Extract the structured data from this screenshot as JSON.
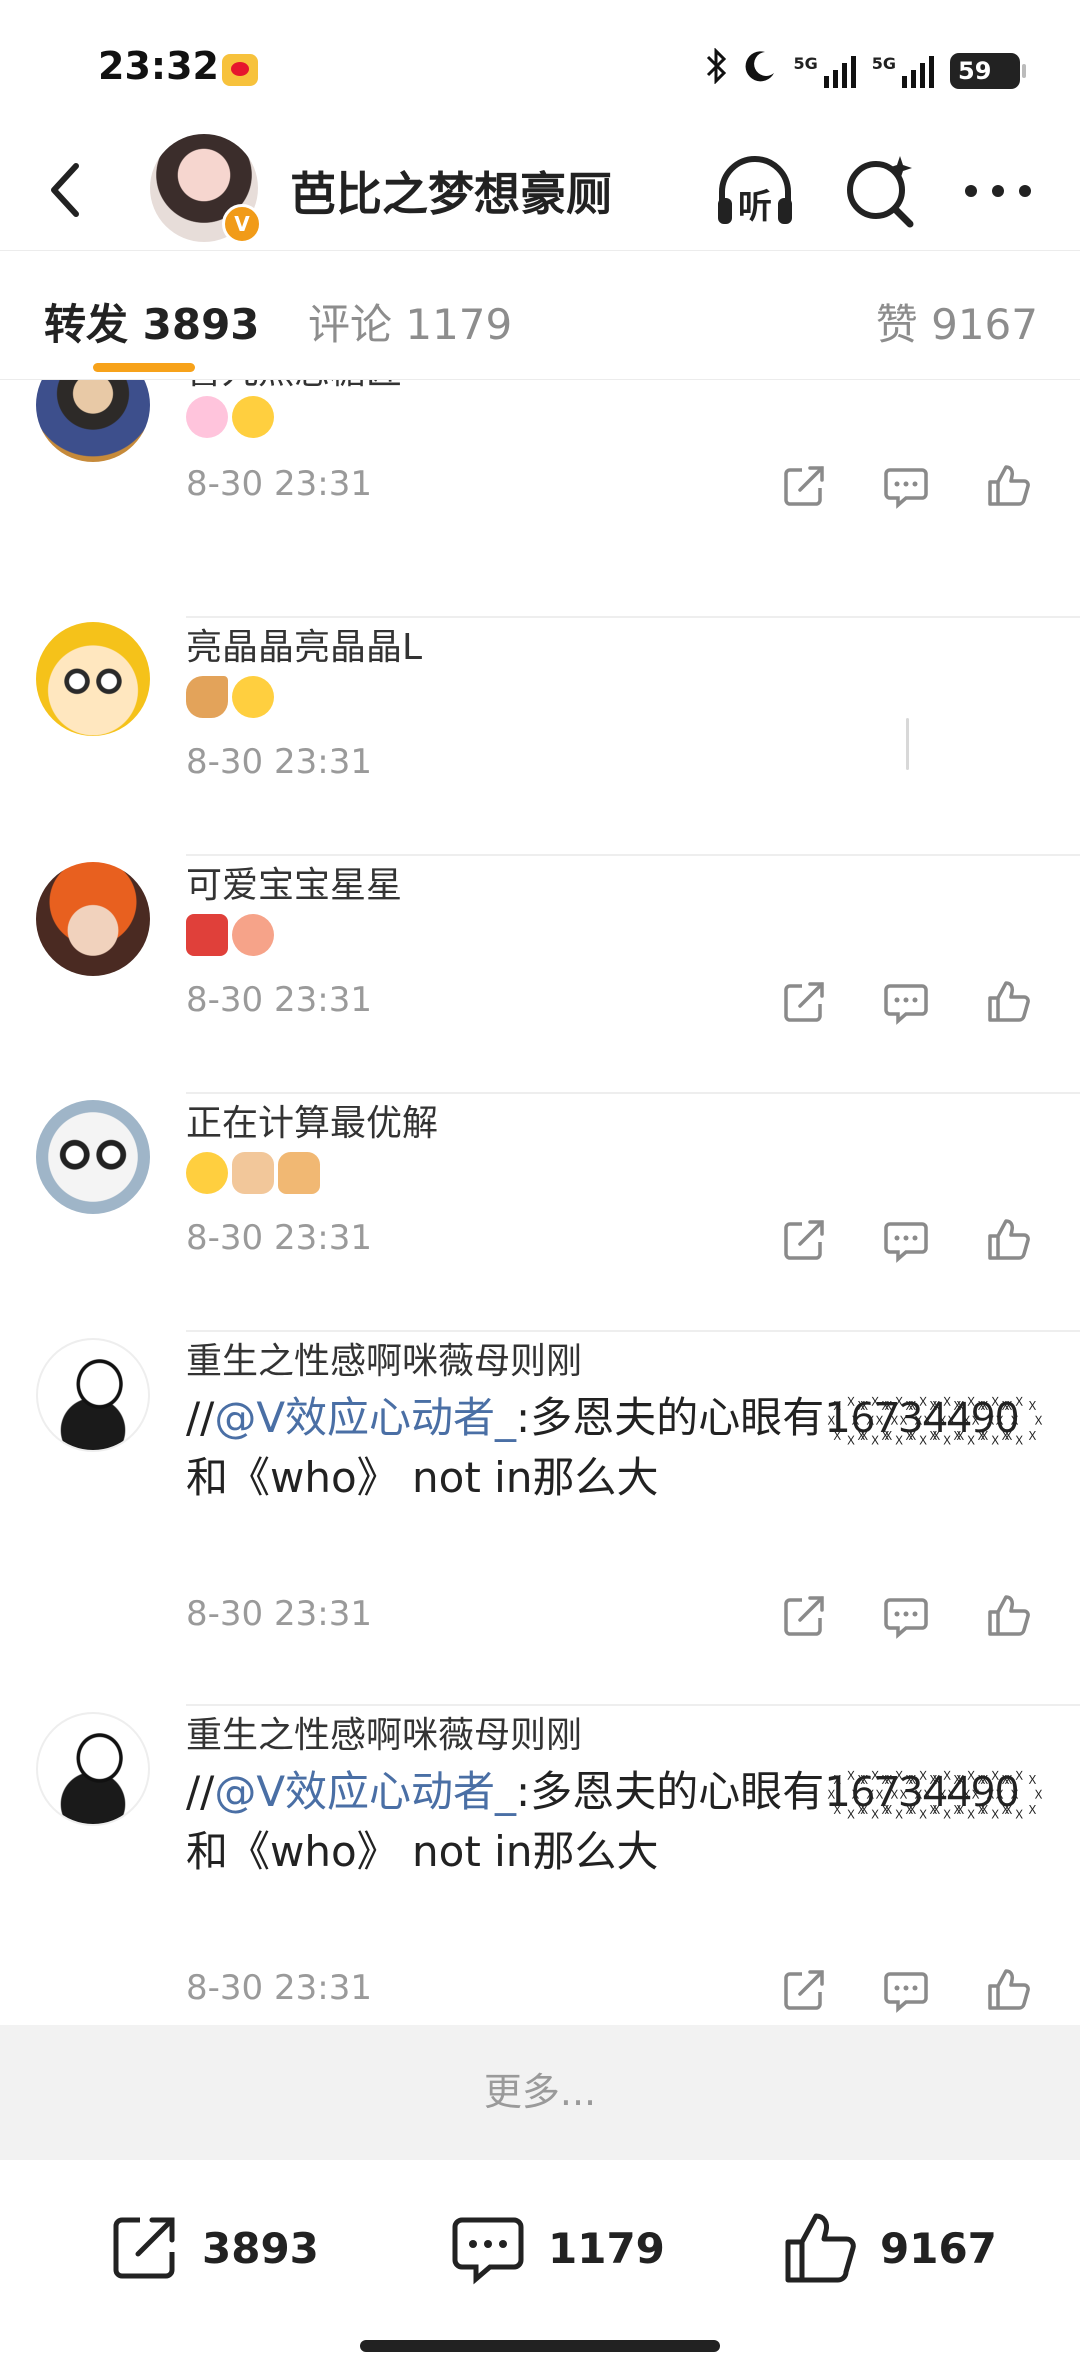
{
  "status": {
    "time": "23:32",
    "net1": "5G",
    "net2": "5G",
    "battery": "59"
  },
  "nav": {
    "title": "芭比之梦想豪厕",
    "listen_label": "听"
  },
  "tabs": {
    "repost": "转发 3893",
    "comment": "评论 1179",
    "likes": "赞 9167"
  },
  "comments": [
    {
      "name": "喜九熙恋糖匠",
      "emojis": [
        "bunny-emoji",
        "grin-emoji"
      ],
      "time": "8-30 23:31"
    },
    {
      "name": "亮晶晶亮晶晶L",
      "emojis": [
        "hand-emoji",
        "smile-emoji"
      ],
      "time": "8-30 23:31"
    },
    {
      "name": "可爱宝宝星星",
      "emojis": [
        "cheers-emoji",
        "pig-emoji"
      ],
      "time": "8-30 23:31"
    },
    {
      "name": "正在计算最优解",
      "emojis": [
        "smile-emoji",
        "ok-hand-emoji",
        "thumbs-up-emoji"
      ],
      "time": "8-30 23:31"
    },
    {
      "name": "重生之性感啊咪薇母则刚",
      "prefix": "//",
      "mention": "@V效应心动者_",
      "text": ":多恩夫的心眼有1꙰6꙰7꙰3꙰4꙰4꙰9꙰0꙰和《who》 not in那么大",
      "time": "8-30 23:31"
    },
    {
      "name": "重生之性感啊咪薇母则刚",
      "prefix": "//",
      "mention": "@V效应心动者_",
      "text": ":多恩夫的心眼有1꙰6꙰7꙰3꙰4꙰4꙰9꙰0꙰和《who》 not in那么大",
      "time": "8-30 23:31"
    }
  ],
  "more": "更多...",
  "bottom": {
    "repost_count": "3893",
    "comment_count": "1179",
    "like_count": "9167"
  },
  "colors": {
    "accent": "#f7a21a",
    "mention": "#4a6fa5",
    "verified": "#f19b18"
  }
}
